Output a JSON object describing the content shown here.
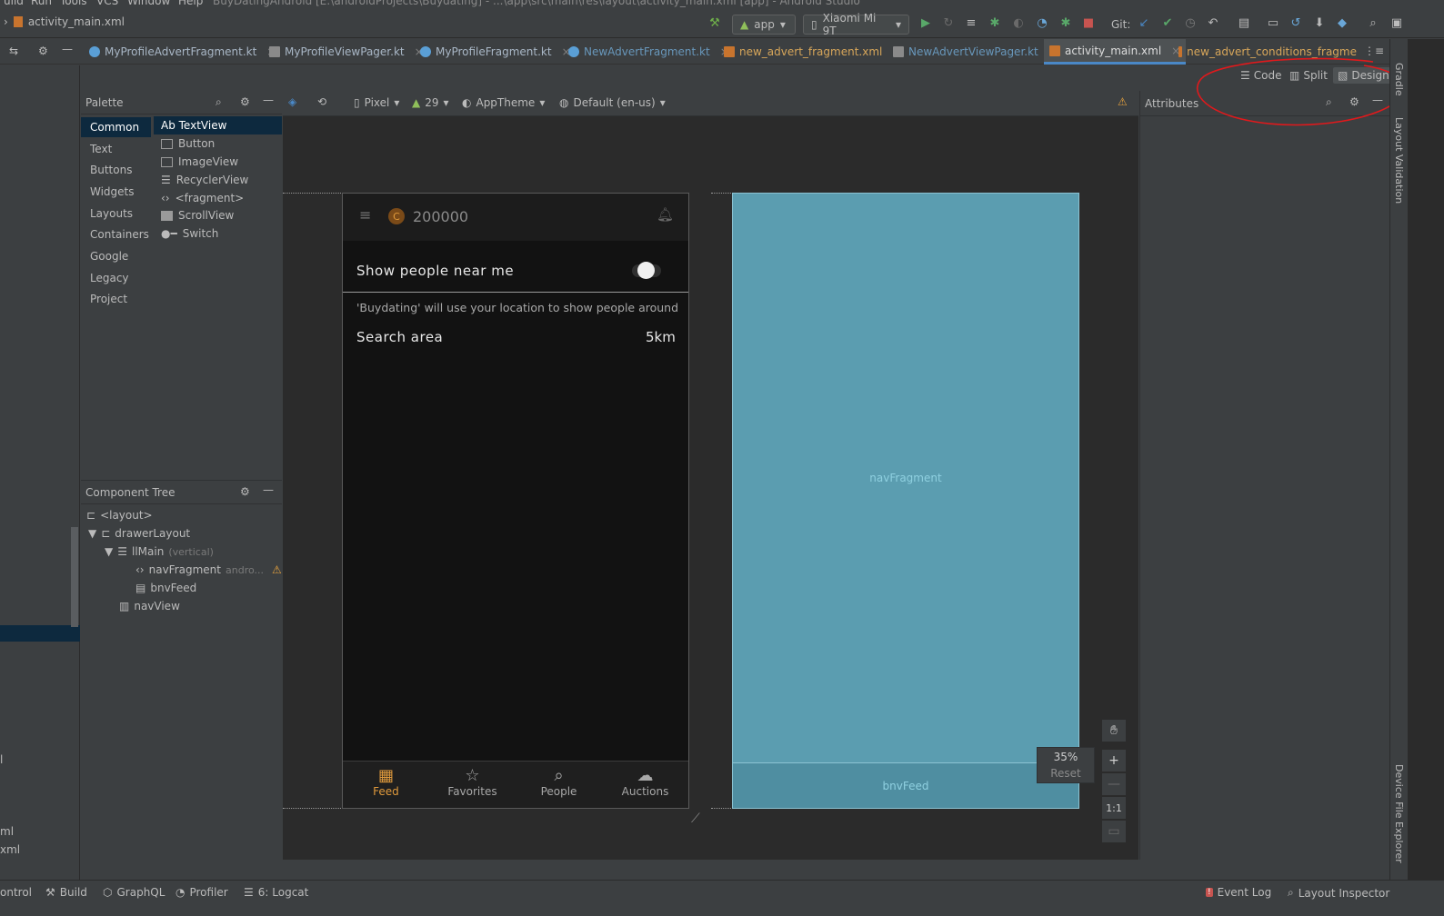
{
  "window": {
    "menu": [
      "uild",
      "Run",
      "Tools",
      "VCS",
      "Window",
      "Help"
    ],
    "title": "BuyDatingAndroid [E:\\androidProjects\\Buydating] - ...\\app\\src\\main\\res\\layout\\activity_main.xml [app] - Android Studio"
  },
  "navbar": {
    "breadcrumb": "activity_main.xml",
    "run_config": "app",
    "device": "Xiaomi Mi 9T",
    "git_label": "Git:"
  },
  "tabs": [
    {
      "label": "MyProfileAdvertFragment.kt",
      "kind": "kt"
    },
    {
      "label": "MyProfileViewPager.kt",
      "kind": "kt"
    },
    {
      "label": "MyProfileFragment.kt",
      "kind": "kt"
    },
    {
      "label": "NewAdvertFragment.kt",
      "kind": "kt-blue"
    },
    {
      "label": "new_advert_fragment.xml",
      "kind": "xml"
    },
    {
      "label": "NewAdvertViewPager.kt",
      "kind": "kt-blue"
    },
    {
      "label": "activity_main.xml",
      "kind": "xml-active"
    },
    {
      "label": "new_advert_conditions_fragme",
      "kind": "xml"
    }
  ],
  "view_modes": {
    "code": "Code",
    "split": "Split",
    "design": "Design"
  },
  "palette": {
    "title": "Palette",
    "categories": [
      "Common",
      "Text",
      "Buttons",
      "Widgets",
      "Layouts",
      "Containers",
      "Google",
      "Legacy",
      "Project"
    ],
    "items": [
      "Ab TextView",
      "Button",
      "ImageView",
      "RecyclerView",
      "<fragment>",
      "ScrollView",
      "Switch"
    ]
  },
  "design_toolbar": {
    "device": "Pixel",
    "api": "29",
    "theme": "AppTheme",
    "locale": "Default (en-us)"
  },
  "component_tree": {
    "title": "Component Tree",
    "nodes": [
      {
        "label": "<layout>",
        "extra": ""
      },
      {
        "label": "drawerLayout",
        "extra": ""
      },
      {
        "label": "llMain",
        "extra": "(vertical)"
      },
      {
        "label": "navFragment",
        "extra": "andro..."
      },
      {
        "label": "bnvFeed",
        "extra": ""
      },
      {
        "label": "navView",
        "extra": ""
      }
    ]
  },
  "phone": {
    "coins": "200000",
    "setting_title": "Show people near me",
    "setting_desc": "'Buydating' will use your location to show people around",
    "search_label": "Search area",
    "search_value": "5km",
    "bottom_nav": [
      {
        "label": "Feed",
        "icon": "grid-icon",
        "active": true
      },
      {
        "label": "Favorites",
        "icon": "star-icon",
        "active": false
      },
      {
        "label": "People",
        "icon": "search-icon",
        "active": false
      },
      {
        "label": "Auctions",
        "icon": "cloud-upload-icon",
        "active": false
      }
    ]
  },
  "blueprint": {
    "nav_fragment_label": "navFragment",
    "bnv_label": "bnvFeed"
  },
  "zoom": {
    "percent": "35%",
    "reset": "Reset",
    "one_to_one": "1:1"
  },
  "attributes": {
    "title": "Attributes"
  },
  "right_tools": [
    "Gradle",
    "Layout Validation",
    "Device File Explorer"
  ],
  "left_edge_texts": [
    "l",
    "ml",
    "xml"
  ],
  "statusbar": {
    "items": [
      "ontrol",
      "Build",
      "GraphQL",
      "Profiler",
      "6: Logcat"
    ],
    "right_items": [
      "Event Log",
      "Layout Inspector"
    ]
  },
  "colors": {
    "accent": "#e09a3c",
    "blueprint": "#5b9db0",
    "selection": "#0d293e",
    "annotation": "#e0191c"
  }
}
